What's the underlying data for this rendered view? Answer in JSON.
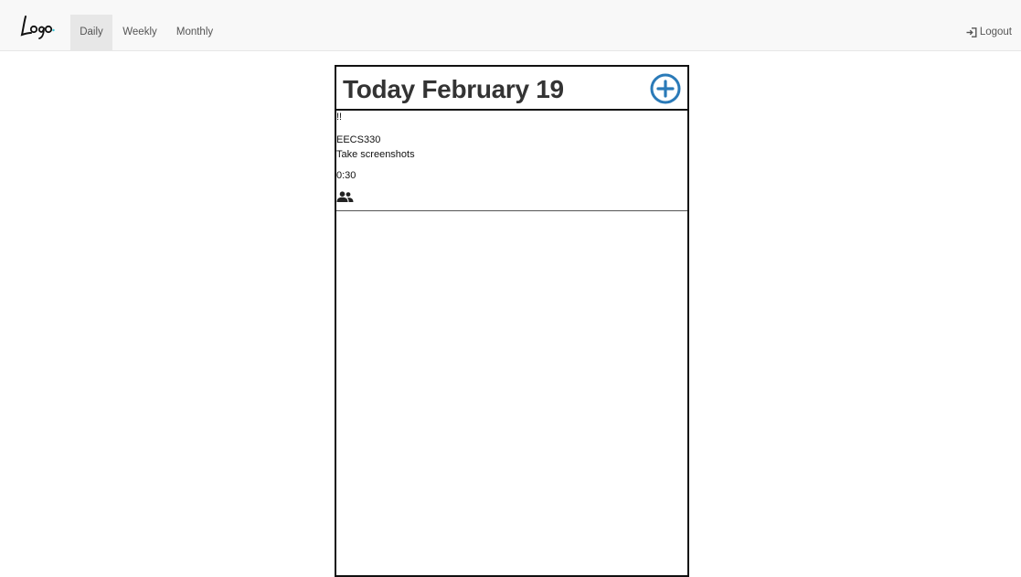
{
  "navbar": {
    "logo_text": "Logo",
    "tabs": [
      {
        "label": "Daily",
        "active": true
      },
      {
        "label": "Weekly",
        "active": false
      },
      {
        "label": "Monthly",
        "active": false
      }
    ],
    "logout_label": "Logout",
    "logout_icon": "sign-in-icon"
  },
  "daily": {
    "title": "Today",
    "date": "February 19",
    "add_icon": "plus-circle-icon",
    "accent_color": "#2a7ab8"
  },
  "task": {
    "priority": "!!",
    "course": "EECS330",
    "description": "Take screenshots",
    "duration": "0:30",
    "icon": "people-icon"
  }
}
